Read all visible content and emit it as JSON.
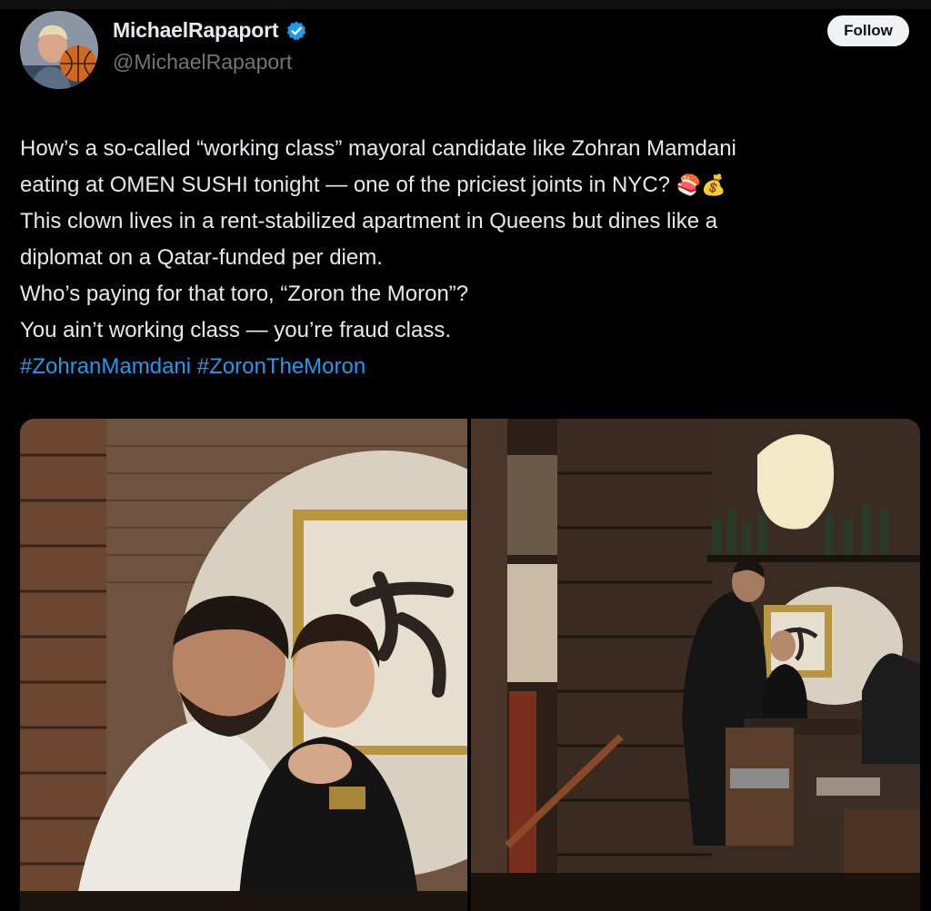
{
  "author": {
    "display_name": "MichaelRapaport",
    "handle": "@MichaelRapaport",
    "verified": true,
    "avatar_icon": "profile-avatar-basketball"
  },
  "follow_label": "Follow",
  "tweet": {
    "lines": [
      "How’s a so-called “working class” mayoral candidate like Zohran Mamdani",
      "eating at OMEN SUSHI tonight — one of the priciest joints in NYC?",
      "This clown lives in a rent-stabilized apartment in Queens but dines like a",
      "diplomat on a Qatar-funded per diem.",
      "Who’s paying for that toro, “Zoron the Moron”?",
      "You ain’t working class — you’re fraud class."
    ],
    "emojis": [
      "🍣",
      "💰"
    ],
    "hashtags": [
      "#ZohranMamdani",
      "#ZoronTheMoron"
    ]
  },
  "media": {
    "left_photo": "restaurant-booth-photo",
    "right_photo": "restaurant-interior-photo"
  },
  "colors": {
    "background": "#000000",
    "text": "#e7e9ea",
    "secondary": "#71767b",
    "link": "#1d9bf0",
    "follow_bg": "#eff3f4"
  }
}
